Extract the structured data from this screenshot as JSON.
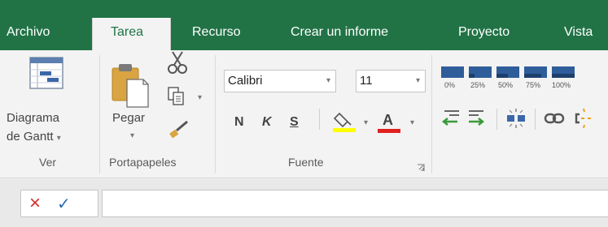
{
  "tabs": [
    {
      "label": "Archivo",
      "active": false
    },
    {
      "label": "Tarea",
      "active": true
    },
    {
      "label": "Recurso",
      "active": false
    },
    {
      "label": "Crear un informe",
      "active": false
    },
    {
      "label": "Proyecto",
      "active": false
    },
    {
      "label": "Vista",
      "active": false
    }
  ],
  "groups": {
    "ver": {
      "label": "Ver",
      "gantt_button_line1": "Diagrama",
      "gantt_button_line2": "de Gantt"
    },
    "portapapeles": {
      "label": "Portapapeles",
      "paste_label": "Pegar"
    },
    "fuente": {
      "label": "Fuente",
      "font_name": "Calibri",
      "font_size": "11",
      "bold_label": "N",
      "italic_label": "K",
      "underline_label": "S",
      "font_color_label": "A"
    },
    "programacion": {
      "percent_labels": [
        "0%",
        "25%",
        "50%",
        "75%",
        "100%"
      ]
    }
  },
  "colors": {
    "accent": "#217346",
    "highlight_yellow": "#ffff00",
    "font_red": "#e02020",
    "cancel_red": "#d0312d",
    "enter_blue": "#2b6cb0",
    "bar_blue": "#2e5d9a"
  },
  "icons": {
    "cancel": "×",
    "enter": "✓"
  }
}
